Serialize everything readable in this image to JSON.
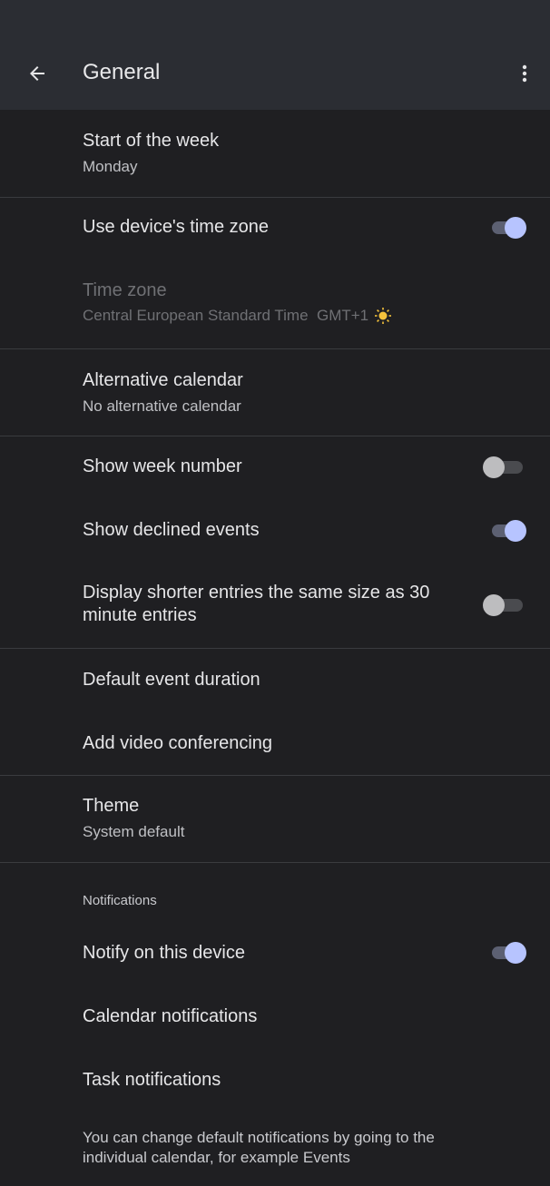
{
  "appbar": {
    "title": "General",
    "back_icon": "arrow-left-icon",
    "more_icon": "more-vert-icon"
  },
  "settings": {
    "start_week": {
      "label": "Start of the week",
      "value": "Monday"
    },
    "device_tz": {
      "label": "Use device's time zone",
      "on": true
    },
    "time_zone": {
      "label": "Time zone",
      "value": "Central European Standard Time  GMT+1",
      "icon": "sun-icon"
    },
    "alt_calendar": {
      "label": "Alternative calendar",
      "value": "No alternative calendar"
    },
    "week_number": {
      "label": "Show week number",
      "on": false
    },
    "declined": {
      "label": "Show declined events",
      "on": true
    },
    "shorter_entries": {
      "label_line1": "Display shorter entries the same size as 30",
      "label_line2": "minute entries",
      "on": false
    },
    "default_duration": {
      "label": "Default event duration"
    },
    "video_conf": {
      "label": "Add video conferencing"
    },
    "theme": {
      "label": "Theme",
      "value": "System default"
    },
    "notifications_header": "Notifications",
    "notify_device": {
      "label": "Notify on this device",
      "on": true
    },
    "calendar_notifications": {
      "label": "Calendar notifications"
    },
    "task_notifications": {
      "label": "Task notifications"
    },
    "footer_line1": "You can change default notifications by going to the",
    "footer_line2": "individual calendar, for example Events"
  },
  "colors": {
    "accent_thumb": "#b7c4ff",
    "appbar_bg": "#2b2d33",
    "page_bg": "#1f1f22"
  }
}
